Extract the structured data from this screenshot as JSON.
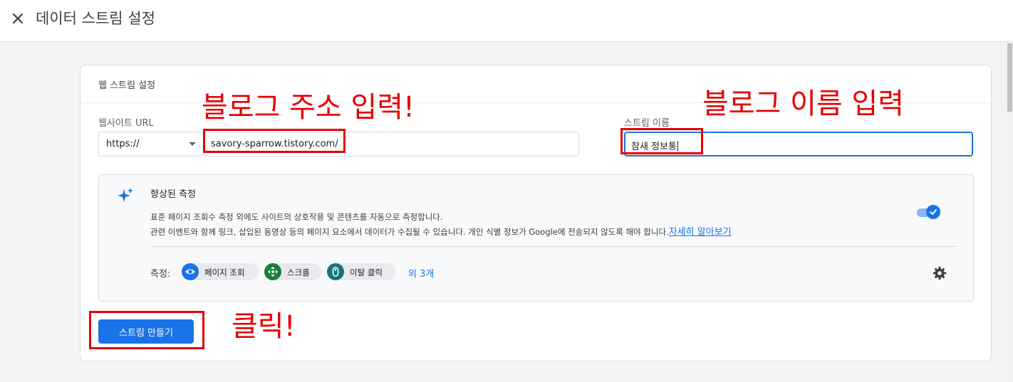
{
  "header": {
    "title": "데이터 스트림 설정",
    "close_icon": "close-icon"
  },
  "card": {
    "title": "웹 스트림 설정",
    "website_url": {
      "label": "웹사이트 URL",
      "protocol": "https://",
      "value": "savory-sparrow.tistory.com/"
    },
    "stream_name": {
      "label": "스트림 이름",
      "value": "참새 정보통"
    },
    "enhanced_measurement": {
      "title": "향상된 측정",
      "description_line1": "표준 페이지 조회수 측정 외에도 사이트의 상호작용 및 콘텐츠를 자동으로 측정합니다.",
      "description_line2": "관련 이벤트와 함께 링크, 삽입된 동영상 등의 페이지 요소에서 데이터가 수집될 수 있습니다. 개인 식별 정보가 Google에 전송되지 않도록 해야 합니다.",
      "learn_more": "자세히 알아보기",
      "enabled": true,
      "measure_label": "측정:",
      "chips": [
        {
          "label": "페이지 조회",
          "icon": "eye-icon",
          "color": "#1a73e8"
        },
        {
          "label": "스크롤",
          "icon": "scroll-icon",
          "color": "#188038"
        },
        {
          "label": "이탈 클릭",
          "icon": "mouse-icon",
          "color": "#12767a"
        }
      ],
      "more_link": "외 3개",
      "settings_icon": "gear-icon"
    },
    "create_button": "스트림 만들기"
  },
  "annotations": {
    "url_note": "블로그 주소 입력!",
    "name_note": "블로그 이름 입력",
    "click_note": "클릭!",
    "color": "#e60000"
  }
}
